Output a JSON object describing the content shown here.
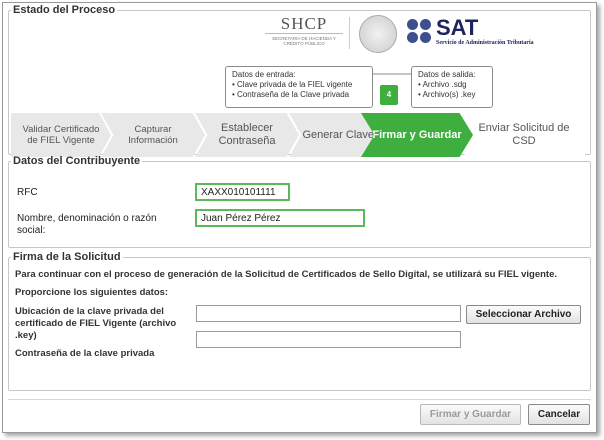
{
  "header": {
    "shcp_logo": "SHCP",
    "shcp_subtitle": "SECRETARÍA DE HACIENDA Y CRÉDITO PÚBLICO",
    "sat_logo": "SAT",
    "sat_subtitle": "Servicio de Administración Tributaria"
  },
  "proceso": {
    "legend": "Estado del Proceso",
    "input_box": {
      "title": "Datos de entrada:",
      "items": [
        "• Clave privada de la FIEL vigente",
        "• Contraseña de la Clave privada"
      ]
    },
    "output_box": {
      "title": "Datos de salida:",
      "items": [
        "• Archivo .sdg",
        "• Archivo(s) .key"
      ]
    },
    "step_badge": "4",
    "steps": [
      {
        "label": "Validar Certificado de FIEL Vigente",
        "active": false
      },
      {
        "label": "Capturar Información",
        "active": false
      },
      {
        "label": "Establecer Contraseña",
        "active": false
      },
      {
        "label": "Generar Claves",
        "active": false
      },
      {
        "label": "Firmar y Guardar",
        "active": true
      },
      {
        "label": "Enviar Solicitud de CSD",
        "active": false
      }
    ]
  },
  "contribuyente": {
    "legend": "Datos del Contribuyente",
    "rfc_label": "RFC",
    "rfc_value": "XAXX010101111",
    "nombre_label": "Nombre, denominación o razón social:",
    "nombre_value": "Juan Pérez Pérez"
  },
  "firma": {
    "legend": "Firma de la Solicitud",
    "intro": "Para continuar con el proceso de generación de la Solicitud de Certificados de Sello Digital, se utilizará su FIEL vigente.",
    "proporcione": "Proporcione los siguientes datos:",
    "ubicacion_label": "Ubicación de la clave privada del certificado de FIEL Vigente (archivo .key)",
    "ubicacion_value": "",
    "seleccionar_label": "Seleccionar Archivo",
    "password_label": "Contraseña de la clave privada",
    "password_value": ""
  },
  "footer": {
    "firmar_label": "Firmar y Guardar",
    "cancelar_label": "Cancelar"
  },
  "colors": {
    "active_step": "#3eae3e",
    "inactive_step": "#e8e8e8",
    "sat_blue": "#1c2560",
    "green_border": "#5cb85c"
  }
}
